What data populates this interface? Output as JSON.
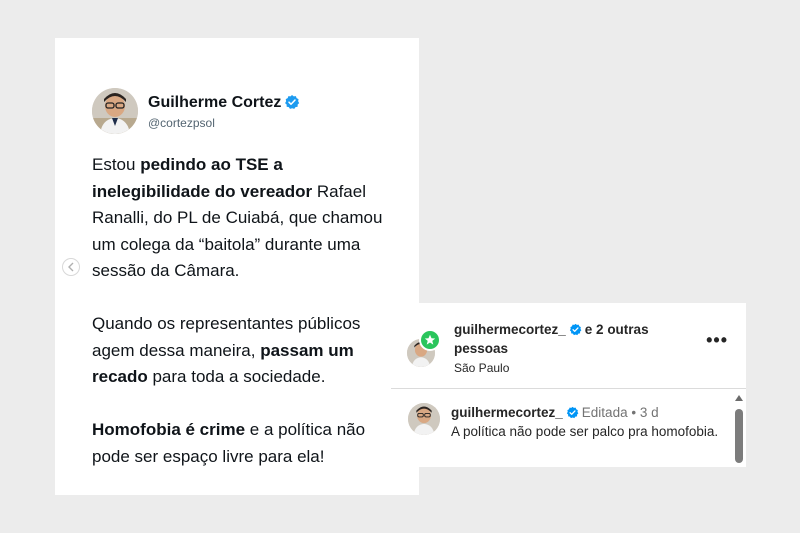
{
  "tweet": {
    "author_name": "Guilherme Cortez",
    "handle": "@cortezpsol",
    "paragraph1": [
      {
        "text": "Estou ",
        "bold": false
      },
      {
        "text": "pedindo ao TSE a inelegibilidade do vereador",
        "bold": true
      },
      {
        "text": " Rafael Ranalli, do PL de Cuiabá, que chamou um colega da “baitola” durante uma sessão da Câmara.",
        "bold": false
      }
    ],
    "paragraph2": [
      {
        "text": "Quando os representantes públicos agem dessa maneira, ",
        "bold": false
      },
      {
        "text": "passam um recado",
        "bold": true
      },
      {
        "text": " para toda a sociedade.",
        "bold": false
      }
    ],
    "paragraph3": [
      {
        "text": "Homofobia é crime",
        "bold": true
      },
      {
        "text": " e a política não pode ser espaço livre para ela!",
        "bold": false
      }
    ],
    "carousel_prev_icon": "chevron-left-icon",
    "verified_color": "#1d9bf0"
  },
  "instagram": {
    "header_username": "guilhermecortez_",
    "header_suffix": "e 2 outras pessoas",
    "location": "São Paulo",
    "more_label": "•••",
    "comment_username": "guilhermecortez_",
    "comment_edited": "Editada",
    "comment_dot": "•",
    "comment_time": "3 d",
    "comment_text": "A política não pode ser palco pra homofobia.",
    "verified_color": "#0095f6",
    "collab_badge_color": "#2ac55c"
  }
}
